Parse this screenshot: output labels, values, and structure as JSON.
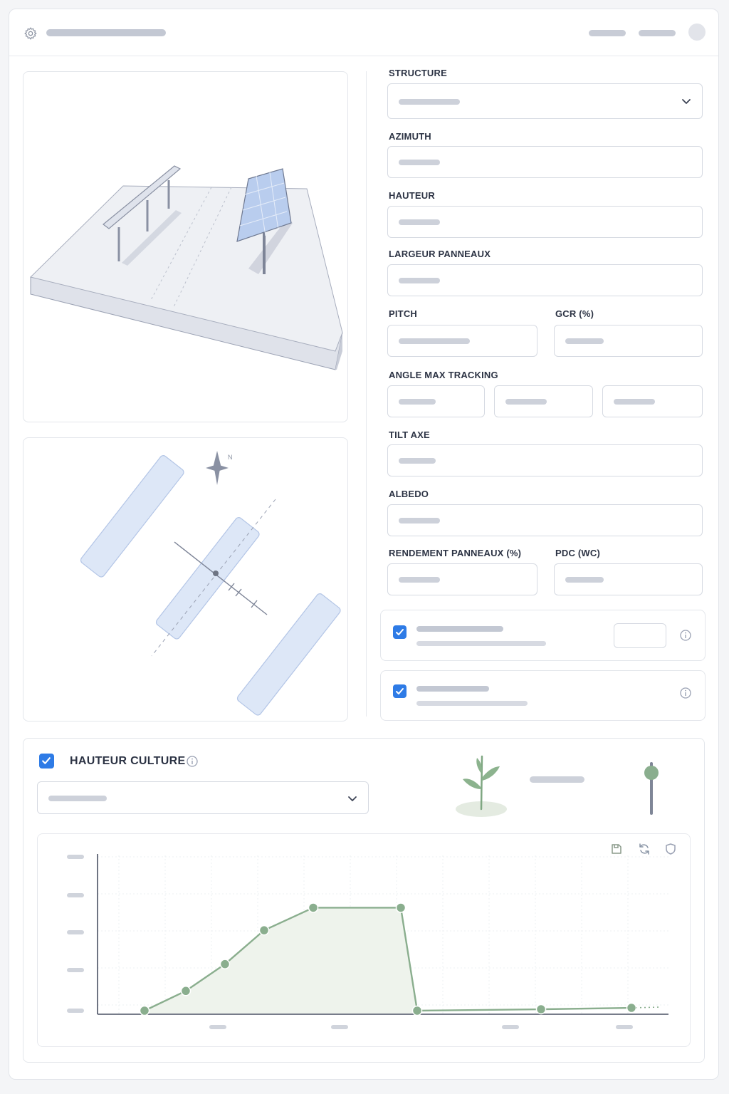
{
  "header": {
    "icon": "gear-icon"
  },
  "form": {
    "structure_label": "STRUCTURE",
    "azimuth_label": "AZIMUTH",
    "hauteur_label": "HAUTEUR",
    "largeur_label": "LARGEUR PANNEAUX",
    "pitch_label": "PITCH",
    "gcr_label": "GCR (%)",
    "angle_label": "ANGLE MAX TRACKING",
    "tilt_label": "TILT AXE",
    "albedo_label": "ALBEDO",
    "rendement_label": "RENDEMENT PANNEAUX (%)",
    "pdc_label": "PDC (WC)"
  },
  "options": [
    {
      "checked": true,
      "icon": "info-icon"
    },
    {
      "checked": true,
      "icon": "info-icon"
    }
  ],
  "culture": {
    "title": "HAUTEUR CULTURE",
    "checked": true,
    "plant_icon": "plant-icon",
    "slider_level": 0.8
  },
  "compass": {
    "north": "N"
  },
  "colors": {
    "accent": "#2e7be6",
    "series": "#8aae8e",
    "panel": "#dde7f7"
  },
  "chart_data": {
    "type": "area",
    "title": "",
    "xlabel": "",
    "ylabel": "",
    "grid": true,
    "x": [
      1,
      2,
      3,
      4,
      5,
      6,
      7,
      8,
      9
    ],
    "series": [
      {
        "values": [
          0,
          0.14,
          0.33,
          0.57,
          0.73,
          0.73,
          0,
          0.01,
          0.02
        ]
      }
    ],
    "ylim": [
      0,
      1
    ],
    "toolbar": [
      "save-icon",
      "refresh-icon",
      "shield-icon"
    ]
  }
}
